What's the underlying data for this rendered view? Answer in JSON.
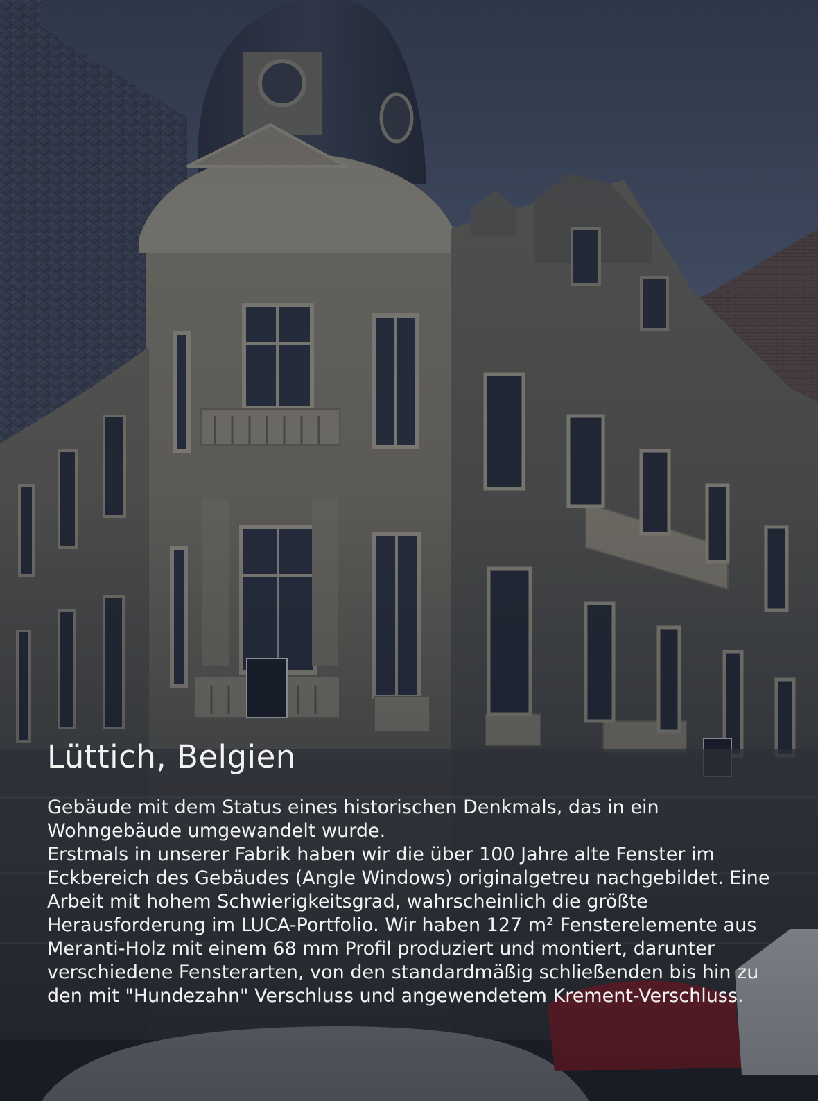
{
  "hero": {
    "title": "Lüttich, Belgien",
    "paragraph_1": "Gebäude mit dem Status eines historischen Denkmals, das in ein Wohngebäude umgewandelt wurde.",
    "paragraph_2": "Erstmals in unserer Fabrik haben wir die über 100 Jahre alte Fenster im Eckbereich des Gebäudes (Angle Windows) originalgetreu nachgebildet. Eine Arbeit mit hohem Schwierigkeitsgrad, wahrscheinlich die größte Herausforderung im LUCA-Portfolio. Wir haben 127 m² Fensterelemente aus Meranti-Holz mit einem 68 mm Profil produziert und montiert, darunter verschiedene Fensterarten, von den standardmäßig schließenden bis hin zu den mit \"Hundezahn\" Verschluss und angewendetem Krement-Verschluss."
  },
  "colors": {
    "text": "#f2f2f2",
    "overlay": "#1a2233",
    "stone": "#8d8677"
  }
}
